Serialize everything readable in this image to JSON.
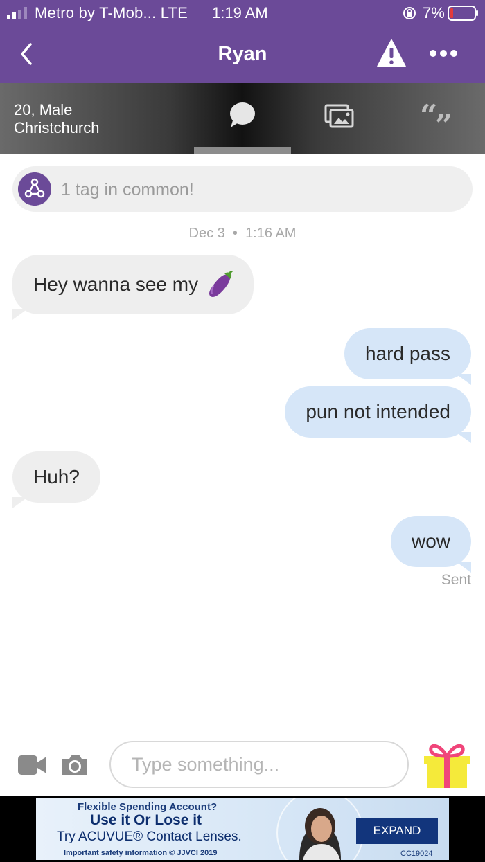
{
  "status_bar": {
    "carrier": "Metro by T-Mob... LTE",
    "time": "1:19 AM",
    "battery_pct": "7%"
  },
  "header": {
    "title": "Ryan"
  },
  "profile": {
    "age_gender": "20, Male",
    "location": "Christchurch",
    "active_tab": "chat"
  },
  "tags": {
    "text": "1 tag in common!"
  },
  "timestamp": {
    "date": "Dec 3",
    "separator": "•",
    "time": "1:16 AM"
  },
  "messages": [
    {
      "from": "them",
      "text": "Hey wanna see my",
      "emoji": "eggplant-emoji"
    },
    {
      "from": "me",
      "text": "hard pass"
    },
    {
      "from": "me",
      "text": "pun not intended"
    },
    {
      "from": "them",
      "text": "Huh?"
    },
    {
      "from": "me",
      "text": "wow"
    }
  ],
  "delivery_status": "Sent",
  "composer": {
    "placeholder": "Type something..."
  },
  "ad": {
    "line1": "Flexible Spending Account?",
    "line2": "Use it Or Lose it",
    "line3": "Try ACUVUE® Contact Lenses.",
    "line4": "Important safety information © JJVCI 2019",
    "code": "CC19024",
    "button": "EXPAND"
  },
  "colors": {
    "brand_purple": "#6b4a98",
    "incoming_bubble": "#eeeeee",
    "outgoing_bubble": "#d6e6f8",
    "gift_pink": "#f0457a",
    "gift_yellow": "#f5ea3a"
  }
}
